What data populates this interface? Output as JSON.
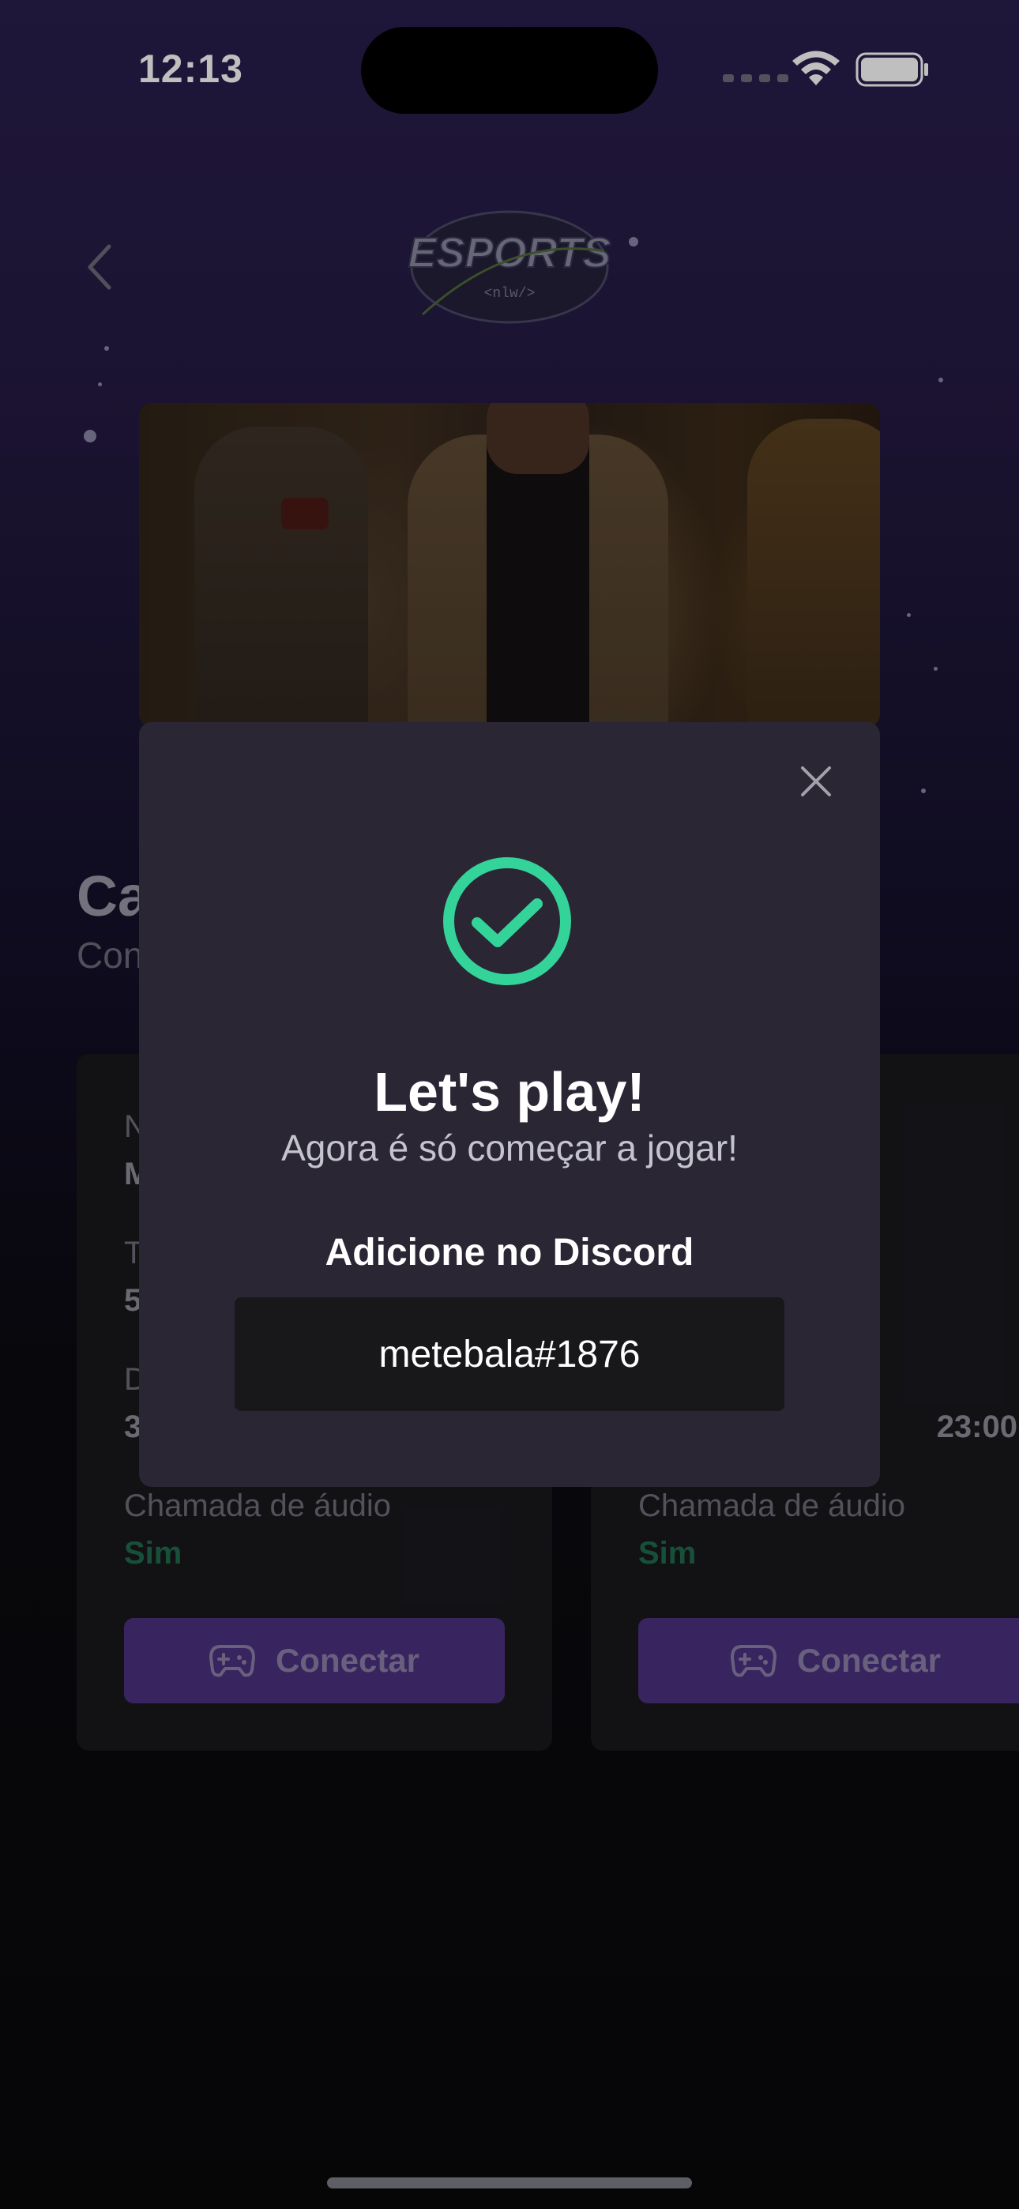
{
  "status_bar": {
    "time": "12:13",
    "icons": [
      "cellular-signal-icon",
      "wifi-icon",
      "battery-icon"
    ]
  },
  "header": {
    "back_icon": "chevron-left-icon",
    "logo_text": "ESPORTS",
    "logo_subtext": "<nlw/>"
  },
  "page": {
    "title_partial": "Ca",
    "subtitle_partial": "Con"
  },
  "ads": [
    {
      "name_label": "N",
      "name_value": "M",
      "time_label": "T",
      "time_value": "5",
      "days_label": "D",
      "days_value": "3",
      "audio_label": "Chamada de áudio",
      "audio_value": "Sim",
      "connect_label": "Conectar"
    },
    {
      "hours_value": "23:00",
      "audio_label": "Chamada de áudio",
      "audio_value": "Sim",
      "connect_label": "Conectar"
    }
  ],
  "modal": {
    "close_icon": "close-icon",
    "success_icon": "check-circle-icon",
    "title": "Let's play!",
    "subtitle": "Agora é só começar a jogar!",
    "discord_label": "Adicione no Discord",
    "discord_tag": "metebala#1876"
  },
  "colors": {
    "background": "#09090a",
    "modal": "#2a2634",
    "success": "#34d399",
    "connect_button": "#8b5cf6",
    "discord_box": "#18181b"
  }
}
